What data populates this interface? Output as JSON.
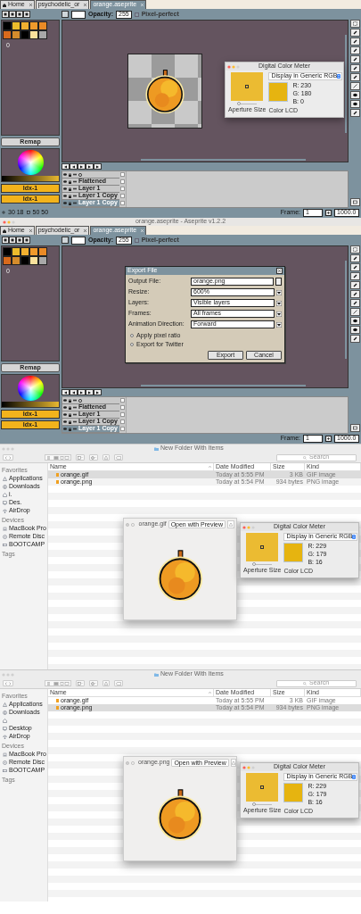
{
  "screens": [
    {
      "kind": "aseprite",
      "tabs": [
        {
          "label": "Home",
          "kind": "home",
          "selected": false
        },
        {
          "label": "psychodelic_or",
          "kind": "file",
          "selected": false
        },
        {
          "label": "orange.aseprite",
          "kind": "file",
          "selected": true
        }
      ],
      "toolbar": {
        "opacity_label": "Opacity:",
        "opacity_value": "255",
        "pixel_perfect": {
          "label": "Pixel-perfect",
          "checked": false
        }
      },
      "palette": {
        "swatches": [
          {
            "color": "#000000"
          },
          {
            "color": "#ecbc2c"
          },
          {
            "color": "#f2b030"
          },
          {
            "color": "#f09a2c"
          },
          {
            "color": "#ea8a26"
          },
          {
            "color": "#d86a1c"
          },
          {
            "color": "#d48c2c"
          },
          {
            "color": "#000000"
          },
          {
            "color": "#fae29c"
          },
          {
            "color": "#a8a8a8"
          }
        ],
        "index": "0"
      },
      "remap": "Remap",
      "color_buttons": [
        "Idx-1",
        "Idx-1"
      ],
      "layers": [
        {
          "kind": "header",
          "selected": false
        },
        {
          "kind": "layer",
          "name": "Flattened",
          "selected": false
        },
        {
          "kind": "layer",
          "name": "Layer 1",
          "selected": false
        },
        {
          "kind": "layer",
          "name": "Layer 1 Copy",
          "selected": false
        },
        {
          "kind": "layer",
          "name": "Layer 1 Copy",
          "selected": true
        }
      ],
      "status": {
        "position": "30 18",
        "size": "50 50",
        "frame_label": "Frame:",
        "frame": "1",
        "zoom": "1000.0"
      },
      "overlay": {
        "kind": "color_meter",
        "title": "Digital Color Meter",
        "dropdown": "Display in Generic RGB",
        "readings": [
          "R: 230",
          "G: 180",
          "B: 0"
        ],
        "display": "Color LCD",
        "aperture": {
          "label": "Aperture Size",
          "level": 0.1
        }
      }
    },
    {
      "kind": "aseprite",
      "title": "orange.aseprite - Aseprite v1.2.2",
      "tabs": [
        {
          "label": "Home",
          "kind": "home",
          "selected": false
        },
        {
          "label": "psychodelic_or",
          "kind": "file",
          "selected": false
        },
        {
          "label": "orange.aseprite",
          "kind": "file",
          "selected": true
        }
      ],
      "toolbar": {
        "opacity_label": "Opacity:",
        "opacity_value": "255",
        "pixel_perfect": {
          "label": "Pixel-perfect",
          "checked": false
        }
      },
      "palette": {
        "swatches": [
          {
            "color": "#000000"
          },
          {
            "color": "#ecbc2c"
          },
          {
            "color": "#f2b030"
          },
          {
            "color": "#f09a2c"
          },
          {
            "color": "#ea8a26"
          },
          {
            "color": "#d86a1c"
          },
          {
            "color": "#d48c2c"
          },
          {
            "color": "#000000"
          },
          {
            "color": "#fae29c"
          },
          {
            "color": "#a8a8a8"
          }
        ],
        "index": "0"
      },
      "remap": "Remap",
      "color_buttons": [
        "Idx-1",
        "Idx-1"
      ],
      "layers": [
        {
          "kind": "header",
          "selected": false
        },
        {
          "kind": "layer",
          "name": "Flattened",
          "selected": false
        },
        {
          "kind": "layer",
          "name": "Layer 1",
          "selected": false
        },
        {
          "kind": "layer",
          "name": "Layer 1 Copy",
          "selected": false
        },
        {
          "kind": "layer",
          "name": "Layer 1 Copy",
          "selected": true
        }
      ],
      "status": {
        "frame_label": "Frame:",
        "frame": "1",
        "zoom": "1000.0"
      },
      "overlay": {
        "kind": "export_dialog",
        "title": "Export File",
        "fields": [
          {
            "kind": "file",
            "label": "Output File:",
            "value": "orange.png"
          },
          {
            "kind": "dropdown",
            "label": "Resize:",
            "value": "600%"
          },
          {
            "kind": "dropdown",
            "label": "Layers:",
            "value": "Visible layers"
          },
          {
            "kind": "dropdown",
            "label": "Frames:",
            "value": "All frames"
          },
          {
            "kind": "dropdown",
            "label": "Animation Direction:",
            "value": "Forward"
          }
        ],
        "options": [
          {
            "label": "Apply pixel ratio",
            "checked": false
          },
          {
            "label": "Export for Twitter",
            "checked": false
          }
        ],
        "buttons": [
          "Export",
          "Cancel"
        ]
      }
    },
    {
      "kind": "finder",
      "title": "New Folder With Items",
      "search": {
        "placeholder": "Search"
      },
      "sidebar": [
        {
          "heading": "Favorites",
          "items": [
            {
              "kind": "applications",
              "label": "Applications"
            },
            {
              "kind": "downloads",
              "label": "Downloads"
            },
            {
              "kind": "home",
              "label": "i."
            },
            {
              "kind": "desktop",
              "label": "Des."
            },
            {
              "kind": "airdrop",
              "label": "AirDrop"
            }
          ]
        },
        {
          "heading": "Devices",
          "items": [
            {
              "kind": "laptop",
              "label": "MacBook Pro"
            },
            {
              "kind": "disc",
              "label": "Remote Disc"
            },
            {
              "kind": "drive",
              "label": "BOOTCAMP"
            }
          ]
        },
        {
          "heading": "Tags"
        }
      ],
      "columns": [
        "Name",
        "Date Modified",
        "Size",
        "Kind"
      ],
      "rows": [
        {
          "name": "orange.gif",
          "date": "Today at 5:55 PM",
          "size": "3 KB",
          "kind": "GIF image",
          "selected": true
        },
        {
          "name": "orange.png",
          "date": "Today at 5:54 PM",
          "size": "934 bytes",
          "kind": "PNG image",
          "selected": false
        }
      ],
      "quicklook": {
        "file": "orange.gif",
        "open_button": "Open with Preview"
      },
      "meter": {
        "title": "Digital Color Meter",
        "dropdown": "Display in Generic RGB",
        "readings": [
          "R: 229",
          "G: 179",
          "B: 16"
        ],
        "display": "Color LCD",
        "aperture": {
          "label": "Aperture Size",
          "level": 0.1
        }
      }
    },
    {
      "kind": "finder",
      "title": "New Folder With Items",
      "search": {
        "placeholder": "Search"
      },
      "sidebar": [
        {
          "heading": "Favorites",
          "items": [
            {
              "kind": "applications",
              "label": "Applications"
            },
            {
              "kind": "downloads",
              "label": "Downloads"
            },
            {
              "kind": "home"
            },
            {
              "kind": "desktop",
              "label": "Desktop"
            },
            {
              "kind": "airdrop",
              "label": "AirDrop"
            }
          ]
        },
        {
          "heading": "Devices",
          "items": [
            {
              "kind": "laptop",
              "label": "MacBook Pro"
            },
            {
              "kind": "disc",
              "label": "Remote Disc"
            },
            {
              "kind": "drive",
              "label": "BOOTCAMP"
            }
          ]
        },
        {
          "heading": "Tags"
        }
      ],
      "columns": [
        "Name",
        "Date Modified",
        "Size",
        "Kind"
      ],
      "rows": [
        {
          "name": "orange.gif",
          "date": "Today at 5:55 PM",
          "size": "3 KB",
          "kind": "GIF image",
          "selected": false
        },
        {
          "name": "orange.png",
          "date": "Today at 5:54 PM",
          "size": "934 bytes",
          "kind": "PNG image",
          "selected": true
        }
      ],
      "quicklook": {
        "file": "orange.png",
        "open_button": "Open with Preview"
      },
      "meter": {
        "title": "Digital Color Meter",
        "dropdown": "Display in Generic RGB",
        "readings": [
          "R: 229",
          "G: 179",
          "B: 16"
        ],
        "display": "Color LCD",
        "aperture": {
          "label": "Aperture Size",
          "level": 0.1
        }
      }
    }
  ]
}
